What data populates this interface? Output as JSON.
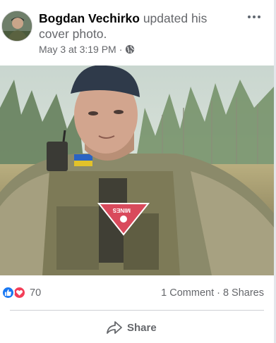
{
  "post": {
    "author": "Bogdan Vechirko",
    "action": "updated his cover photo.",
    "timestamp": "May 3 at 3:19 PM",
    "separator": "·",
    "privacy_icon": "globe-icon",
    "more_icon": "more-horizontal-icon"
  },
  "photo": {
    "patch_text": "MINES"
  },
  "stats": {
    "reaction_icons": [
      "like-icon",
      "love-icon"
    ],
    "reaction_count": "70",
    "comments": "1 Comment",
    "dot": "·",
    "shares": "8 Shares"
  },
  "actions": {
    "share_label": "Share",
    "share_icon": "share-arrow-icon"
  },
  "colors": {
    "like": "#1877f2",
    "love": "#f33e58",
    "meta_text": "#65676b"
  }
}
